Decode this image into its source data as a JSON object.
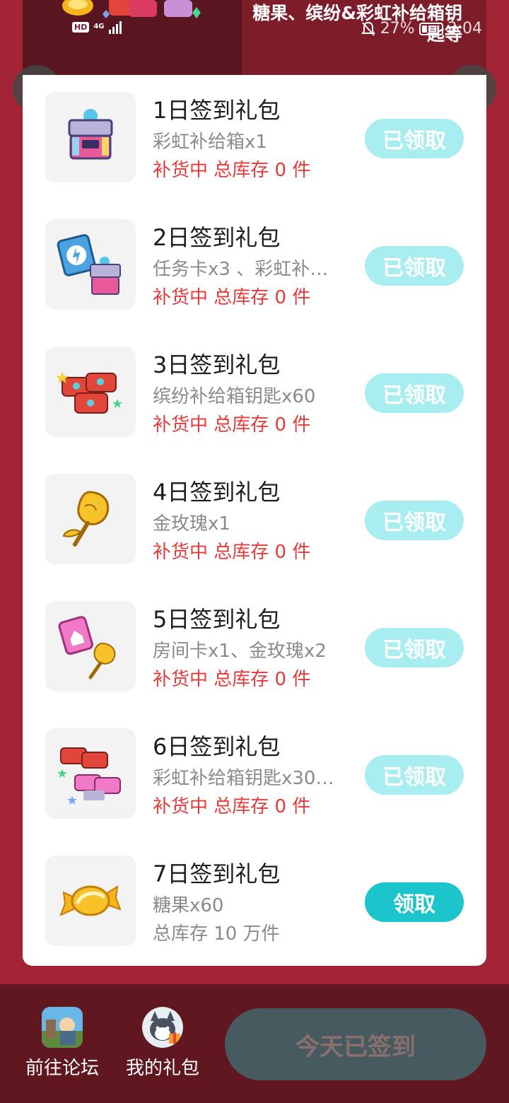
{
  "status_bar": {
    "hd": "HD",
    "network": "4G",
    "battery": "27%",
    "battery_level": 0.27,
    "time": "3:04"
  },
  "banner": {
    "text": "糖果、缤纷&彩虹补给箱钥匙等"
  },
  "icons": {
    "back": "chevron-left-icon",
    "share": "share-icon"
  },
  "items": [
    {
      "title": "1日签到礼包",
      "desc": "彩虹补给箱x1",
      "stock": "补货中 总库存 0 件",
      "button": "已领取",
      "claimed": true,
      "thumb": "rainbow-supply-box-icon"
    },
    {
      "title": "2日签到礼包",
      "desc": "任务卡x3 、彩虹补…",
      "stock": "补货中 总库存 0 件",
      "button": "已领取",
      "claimed": true,
      "thumb": "task-card-and-box-icon"
    },
    {
      "title": "3日签到礼包",
      "desc": "缤纷补给箱钥匙x60",
      "stock": "补货中 总库存 0 件",
      "button": "已领取",
      "claimed": true,
      "thumb": "colorful-box-keys-icon"
    },
    {
      "title": "4日签到礼包",
      "desc": "金玫瑰x1",
      "stock": "补货中 总库存 0 件",
      "button": "已领取",
      "claimed": true,
      "thumb": "gold-rose-icon"
    },
    {
      "title": "5日签到礼包",
      "desc": "房间卡x1、金玫瑰x2",
      "stock": "补货中 总库存 0 件",
      "button": "已领取",
      "claimed": true,
      "thumb": "room-card-and-rose-icon"
    },
    {
      "title": "6日签到礼包",
      "desc": "彩虹补给箱钥匙x30…",
      "stock": "补货中 总库存 0 件",
      "button": "已领取",
      "claimed": true,
      "thumb": "rainbow-keys-icon"
    },
    {
      "title": "7日签到礼包",
      "desc": "糖果x60",
      "stock": "总库存 10 万件",
      "button": "领取",
      "claimed": false,
      "thumb": "candy-icon"
    }
  ],
  "bottom": {
    "forum_label": "前往论坛",
    "gifts_label": "我的礼包",
    "checkin_label": "今天已签到"
  },
  "colors": {
    "background": "#a32535",
    "claimed_button": "#a8eef0",
    "claim_button": "#1bc5cb",
    "stock_red": "#e53a3a"
  }
}
